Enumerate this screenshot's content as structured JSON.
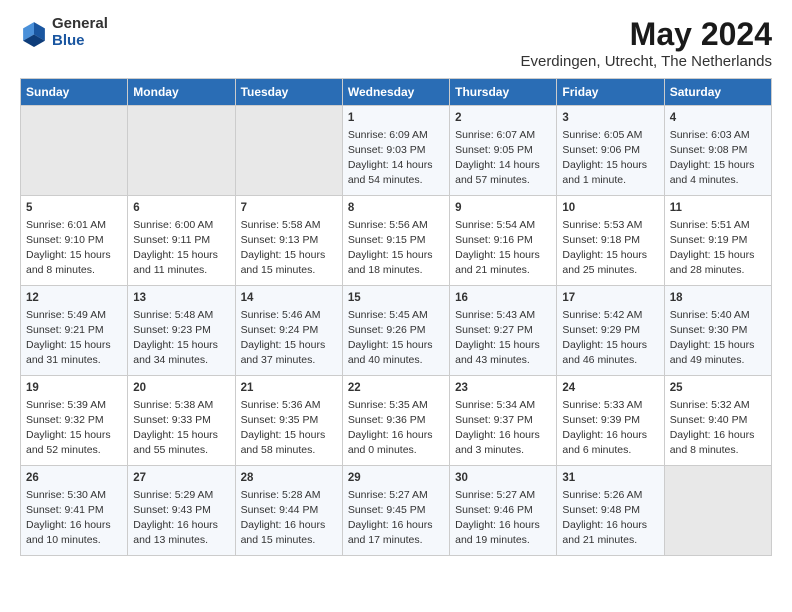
{
  "header": {
    "logo_general": "General",
    "logo_blue": "Blue",
    "month_year": "May 2024",
    "location": "Everdingen, Utrecht, The Netherlands"
  },
  "days_of_week": [
    "Sunday",
    "Monday",
    "Tuesday",
    "Wednesday",
    "Thursday",
    "Friday",
    "Saturday"
  ],
  "weeks": [
    [
      {
        "day": "",
        "info": ""
      },
      {
        "day": "",
        "info": ""
      },
      {
        "day": "",
        "info": ""
      },
      {
        "day": "1",
        "info": "Sunrise: 6:09 AM\nSunset: 9:03 PM\nDaylight: 14 hours\nand 54 minutes."
      },
      {
        "day": "2",
        "info": "Sunrise: 6:07 AM\nSunset: 9:05 PM\nDaylight: 14 hours\nand 57 minutes."
      },
      {
        "day": "3",
        "info": "Sunrise: 6:05 AM\nSunset: 9:06 PM\nDaylight: 15 hours\nand 1 minute."
      },
      {
        "day": "4",
        "info": "Sunrise: 6:03 AM\nSunset: 9:08 PM\nDaylight: 15 hours\nand 4 minutes."
      }
    ],
    [
      {
        "day": "5",
        "info": "Sunrise: 6:01 AM\nSunset: 9:10 PM\nDaylight: 15 hours\nand 8 minutes."
      },
      {
        "day": "6",
        "info": "Sunrise: 6:00 AM\nSunset: 9:11 PM\nDaylight: 15 hours\nand 11 minutes."
      },
      {
        "day": "7",
        "info": "Sunrise: 5:58 AM\nSunset: 9:13 PM\nDaylight: 15 hours\nand 15 minutes."
      },
      {
        "day": "8",
        "info": "Sunrise: 5:56 AM\nSunset: 9:15 PM\nDaylight: 15 hours\nand 18 minutes."
      },
      {
        "day": "9",
        "info": "Sunrise: 5:54 AM\nSunset: 9:16 PM\nDaylight: 15 hours\nand 21 minutes."
      },
      {
        "day": "10",
        "info": "Sunrise: 5:53 AM\nSunset: 9:18 PM\nDaylight: 15 hours\nand 25 minutes."
      },
      {
        "day": "11",
        "info": "Sunrise: 5:51 AM\nSunset: 9:19 PM\nDaylight: 15 hours\nand 28 minutes."
      }
    ],
    [
      {
        "day": "12",
        "info": "Sunrise: 5:49 AM\nSunset: 9:21 PM\nDaylight: 15 hours\nand 31 minutes."
      },
      {
        "day": "13",
        "info": "Sunrise: 5:48 AM\nSunset: 9:23 PM\nDaylight: 15 hours\nand 34 minutes."
      },
      {
        "day": "14",
        "info": "Sunrise: 5:46 AM\nSunset: 9:24 PM\nDaylight: 15 hours\nand 37 minutes."
      },
      {
        "day": "15",
        "info": "Sunrise: 5:45 AM\nSunset: 9:26 PM\nDaylight: 15 hours\nand 40 minutes."
      },
      {
        "day": "16",
        "info": "Sunrise: 5:43 AM\nSunset: 9:27 PM\nDaylight: 15 hours\nand 43 minutes."
      },
      {
        "day": "17",
        "info": "Sunrise: 5:42 AM\nSunset: 9:29 PM\nDaylight: 15 hours\nand 46 minutes."
      },
      {
        "day": "18",
        "info": "Sunrise: 5:40 AM\nSunset: 9:30 PM\nDaylight: 15 hours\nand 49 minutes."
      }
    ],
    [
      {
        "day": "19",
        "info": "Sunrise: 5:39 AM\nSunset: 9:32 PM\nDaylight: 15 hours\nand 52 minutes."
      },
      {
        "day": "20",
        "info": "Sunrise: 5:38 AM\nSunset: 9:33 PM\nDaylight: 15 hours\nand 55 minutes."
      },
      {
        "day": "21",
        "info": "Sunrise: 5:36 AM\nSunset: 9:35 PM\nDaylight: 15 hours\nand 58 minutes."
      },
      {
        "day": "22",
        "info": "Sunrise: 5:35 AM\nSunset: 9:36 PM\nDaylight: 16 hours\nand 0 minutes."
      },
      {
        "day": "23",
        "info": "Sunrise: 5:34 AM\nSunset: 9:37 PM\nDaylight: 16 hours\nand 3 minutes."
      },
      {
        "day": "24",
        "info": "Sunrise: 5:33 AM\nSunset: 9:39 PM\nDaylight: 16 hours\nand 6 minutes."
      },
      {
        "day": "25",
        "info": "Sunrise: 5:32 AM\nSunset: 9:40 PM\nDaylight: 16 hours\nand 8 minutes."
      }
    ],
    [
      {
        "day": "26",
        "info": "Sunrise: 5:30 AM\nSunset: 9:41 PM\nDaylight: 16 hours\nand 10 minutes."
      },
      {
        "day": "27",
        "info": "Sunrise: 5:29 AM\nSunset: 9:43 PM\nDaylight: 16 hours\nand 13 minutes."
      },
      {
        "day": "28",
        "info": "Sunrise: 5:28 AM\nSunset: 9:44 PM\nDaylight: 16 hours\nand 15 minutes."
      },
      {
        "day": "29",
        "info": "Sunrise: 5:27 AM\nSunset: 9:45 PM\nDaylight: 16 hours\nand 17 minutes."
      },
      {
        "day": "30",
        "info": "Sunrise: 5:27 AM\nSunset: 9:46 PM\nDaylight: 16 hours\nand 19 minutes."
      },
      {
        "day": "31",
        "info": "Sunrise: 5:26 AM\nSunset: 9:48 PM\nDaylight: 16 hours\nand 21 minutes."
      },
      {
        "day": "",
        "info": ""
      }
    ]
  ]
}
